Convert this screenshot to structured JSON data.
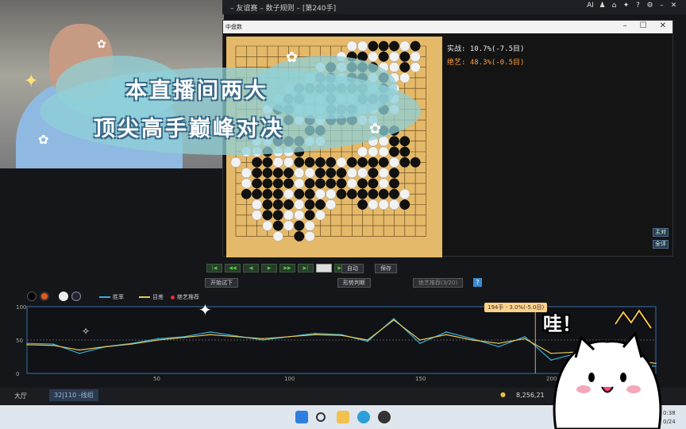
{
  "app": {
    "title_parts": [
      "友谊赛",
      "数子规则",
      "[第240手]"
    ],
    "topbar_icons": [
      "ai-icon",
      "user-icon",
      "home-icon",
      "gift-icon",
      "help-icon",
      "settings-icon",
      "minimize-icon",
      "close-icon"
    ],
    "ai_label": "AI"
  },
  "board_window": {
    "title": "中盘数",
    "controls": [
      "–",
      "☐",
      "✕"
    ]
  },
  "info": {
    "line1": "实战: 10.7%(-7.5目)",
    "line2": "绝艺: 48.3%(-0.5目)"
  },
  "side_buttons": [
    "主对",
    "全评"
  ],
  "nav": {
    "buttons": [
      "|◀",
      "◀◀",
      "◀",
      "▶",
      "▶▶",
      "▶|",
      "",
      "▶▶|"
    ],
    "auto": "自动",
    "save": "保存",
    "start_trial": "开始试下",
    "situation": "形势判断",
    "recommend": "绝艺推荐(3/20)"
  },
  "legend": {
    "winrate": "胜率",
    "score": "目差",
    "ai": "绝艺推荐",
    "winrate_color": "#3ab0d8",
    "score_color": "#e6c85a",
    "ai_color": "#e03030"
  },
  "chart_data": {
    "type": "line",
    "x": [
      0,
      10,
      20,
      30,
      40,
      50,
      60,
      70,
      80,
      90,
      100,
      110,
      120,
      130,
      140,
      150,
      160,
      170,
      180,
      190,
      200,
      210,
      220,
      230,
      240
    ],
    "series": [
      {
        "name": "胜率",
        "values": [
          45,
          44,
          30,
          40,
          45,
          52,
          55,
          62,
          56,
          50,
          55,
          60,
          58,
          48,
          82,
          45,
          62,
          52,
          40,
          55,
          20,
          30,
          28,
          15,
          10.7
        ]
      },
      {
        "name": "目差",
        "values": [
          43,
          42,
          35,
          40,
          44,
          50,
          54,
          58,
          55,
          52,
          55,
          58,
          57,
          50,
          80,
          50,
          58,
          50,
          45,
          52,
          30,
          32,
          30,
          20,
          15
        ]
      }
    ],
    "ylim": [
      0,
      100
    ],
    "xlim": [
      0,
      240
    ],
    "y_ticks": [
      "100",
      "50",
      "0"
    ],
    "x_ticks": [
      "50",
      "100",
      "150",
      "200"
    ],
    "tooltip": "194手 - 3.0%(-5.0目)"
  },
  "app_taskbar": {
    "hall": "大厅",
    "tab": "32|110 -线组",
    "coins": "8,256,21"
  },
  "overlay": {
    "caption_line1": "本直播间两大",
    "caption_line2": "顶尖高手巅峰对决",
    "wa": "哇！"
  },
  "clock": {
    "time": "0:38",
    "date": "0/24"
  }
}
